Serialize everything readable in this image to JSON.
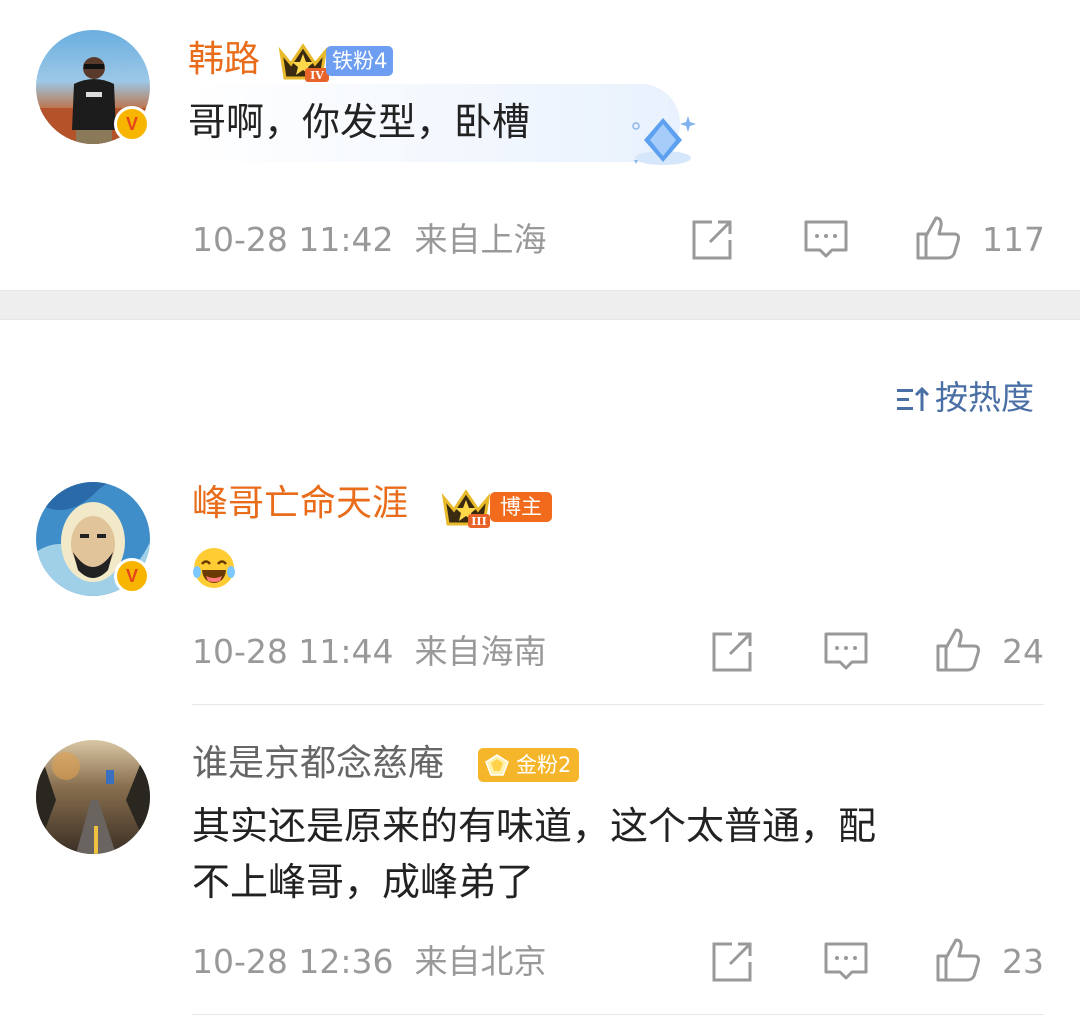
{
  "comment_top": {
    "username": "韩路",
    "badge_label": "铁粉4",
    "text": "哥啊，你发型，卧槽",
    "time": "10-28 11:42",
    "location": "来自上海",
    "likes": "117",
    "verified_mark": "V"
  },
  "sort": {
    "label": "按热度"
  },
  "comments": [
    {
      "username": "峰哥亡命天涯",
      "badge_label": "博主",
      "text": "😂",
      "time": "10-28 11:44",
      "location": "来自海南",
      "likes": "24",
      "verified_mark": "V"
    },
    {
      "username": "谁是京都念慈庵",
      "badge_label": "金粉2",
      "text_line1": "其实还是原来的有味道，这个太普通，配",
      "text_line2": "不上峰哥，成峰弟了",
      "time": "10-28 12:36",
      "location": "来自北京",
      "likes": "23"
    }
  ],
  "icons": {
    "share": "share-icon",
    "comment": "comment-icon",
    "like": "thumbs-up-icon",
    "sort": "sort-icon"
  },
  "colors": {
    "username": "#e86c1a",
    "meta_text": "#999999",
    "sort_link": "#4a6fa5",
    "fan_badge": "#6e9ef2",
    "blogger_badge": "#f26b1d",
    "gold_badge": "#f5b62c"
  }
}
